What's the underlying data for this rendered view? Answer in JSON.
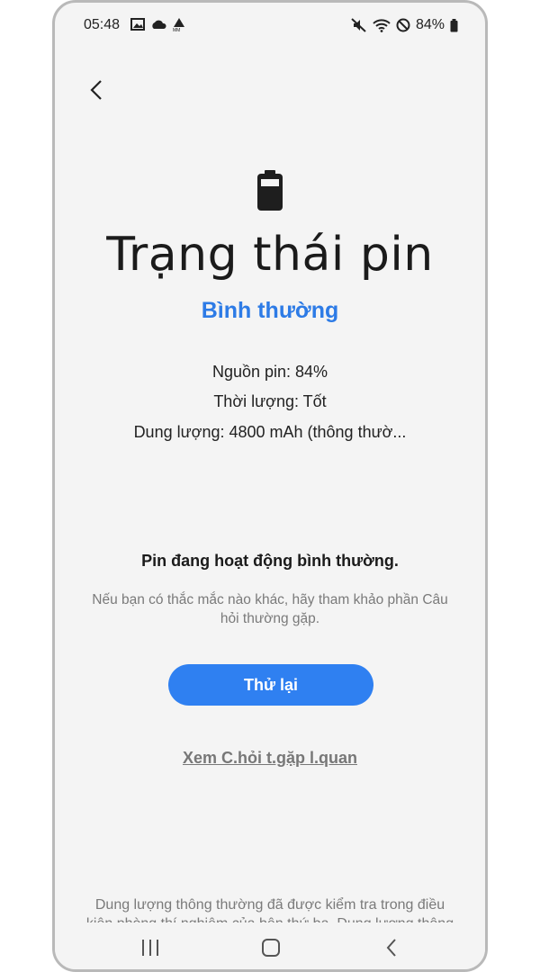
{
  "status_bar": {
    "time": "05:48",
    "battery_percent": "84%",
    "left_icons": [
      "gallery-icon",
      "cloud-icon",
      "mm-icon"
    ],
    "right_icons": [
      "mute-icon",
      "wifi-icon",
      "do-not-disturb-icon",
      "battery-icon"
    ]
  },
  "header": {
    "back_icon": "chevron-left-icon"
  },
  "main": {
    "icon": "battery-icon",
    "title": "Trạng thái pin",
    "status": "Bình thường",
    "status_color": "#2d7be6",
    "info": [
      "Nguồn pin: 84%",
      "Thời lượng: Tốt",
      "Dung lượng:  4800 mAh (thông thườ..."
    ],
    "normal_message": "Pin đang hoạt động bình thường.",
    "faq_note": "Nếu bạn có thắc mắc nào khác, hãy tham khảo phần Câu hỏi thường gặp.",
    "retry_label": "Thử lại",
    "faq_link": "Xem C.hỏi t.gặp l.quan",
    "footnote": "Dung lượng thông thường đã được kiểm tra trong điều kiện phòng thí nghiệm của bên thứ ba. Dung lượng thông"
  },
  "navbar": {
    "items": [
      "recent-apps-icon",
      "home-icon",
      "back-icon"
    ]
  },
  "colors": {
    "accent": "#2f80f1",
    "background": "#f4f4f4"
  }
}
